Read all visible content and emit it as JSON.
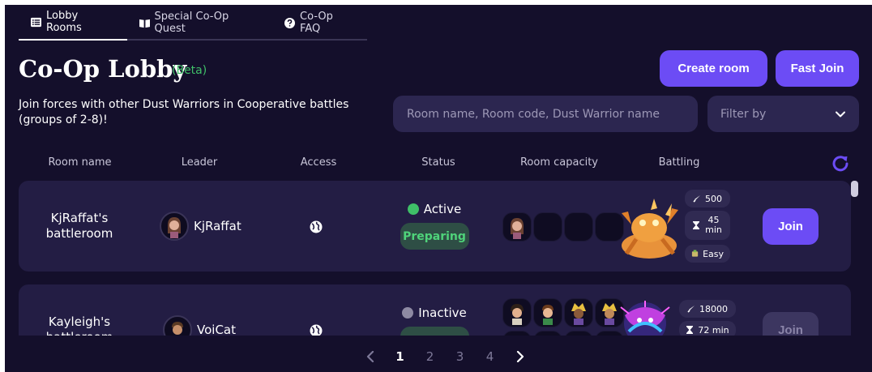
{
  "tabs": [
    {
      "label": "Lobby Rooms",
      "icon": "list-icon",
      "active": true
    },
    {
      "label": "Special Co-Op Quest",
      "icon": "book-icon",
      "active": false
    },
    {
      "label": "Co-Op FAQ",
      "icon": "question-icon",
      "active": false
    }
  ],
  "header": {
    "title": "Co-Op Lobby",
    "beta": "(Beta)",
    "description": "Join forces with other Dust Warriors in Cooperative battles (groups of 2-8)!",
    "create_room": "Create room",
    "fast_join": "Fast Join"
  },
  "search": {
    "placeholder": "Room name, Room code, Dust Warrior name"
  },
  "filter": {
    "label": "Filter by"
  },
  "columns": [
    "Room name",
    "Leader",
    "Access",
    "Status",
    "Room capacity",
    "Battling"
  ],
  "rows": [
    {
      "room_name": "KjRaffat's battleroom",
      "leader": "KjRaffat",
      "status": "Active",
      "phase": "Preparing",
      "damage": "500",
      "time": "45 min",
      "difficulty": "Easy",
      "join": "Join"
    },
    {
      "room_name": "Kayleigh's battleroom",
      "leader": "VoiCat",
      "status": "Inactive",
      "phase": "",
      "damage": "18000",
      "time": "72 min",
      "difficulty": "",
      "join": "Join"
    }
  ],
  "pagination": {
    "pages": [
      "1",
      "2",
      "3",
      "4"
    ],
    "current": "1"
  },
  "colors": {
    "accent": "#6c4cf5",
    "background": "#140f2b",
    "card": "#231d44",
    "active": "#3fbf68",
    "inactive": "#8e8aa3"
  }
}
